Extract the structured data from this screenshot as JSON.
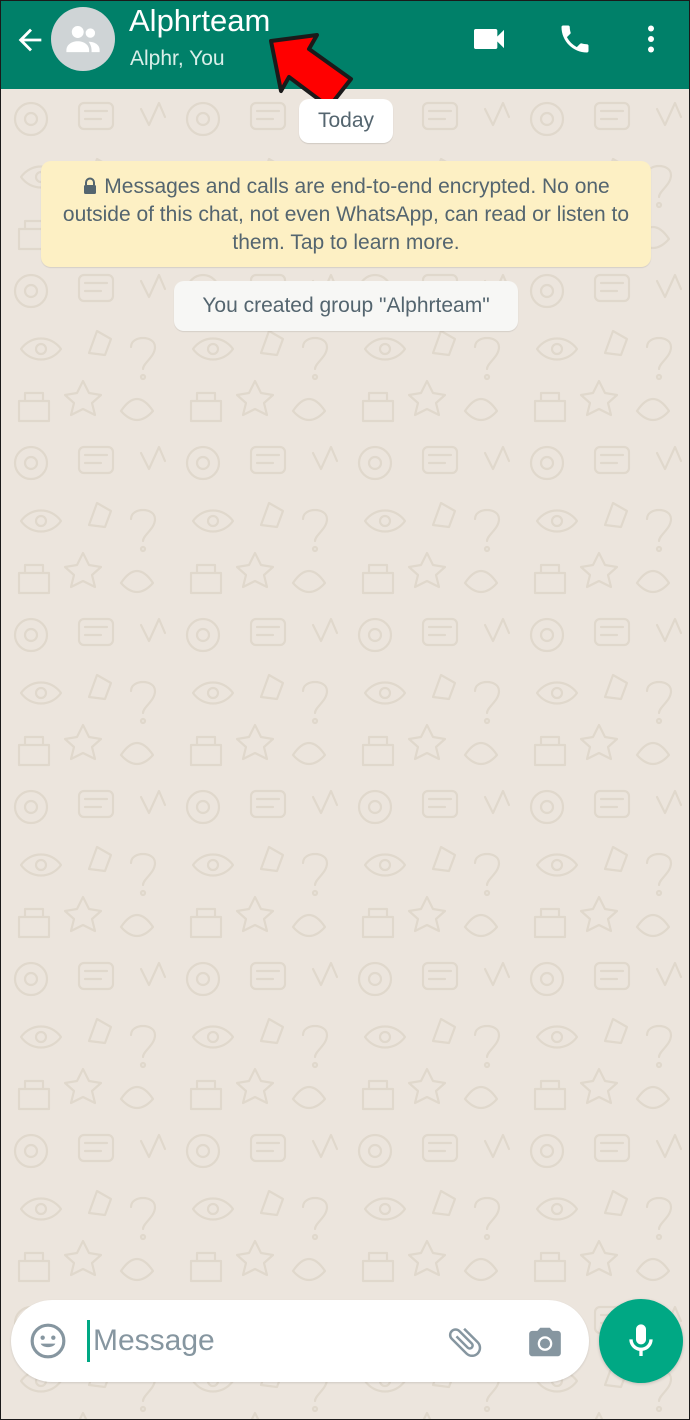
{
  "header": {
    "title": "Alphrteam",
    "subtitle": "Alphr, You",
    "icons": {
      "back": "arrow-back-icon",
      "avatar": "group-avatar-icon",
      "video_call": "videocam-icon",
      "voice_call": "phone-icon",
      "menu": "more-vert-icon"
    }
  },
  "chat": {
    "date_label": "Today",
    "encryption_notice": "Messages and calls are end-to-end encrypted. No one outside of this chat, not even WhatsApp, can read or listen to them. Tap to learn more.",
    "system_message": "You created group \"Alphrteam\""
  },
  "composer": {
    "placeholder": "Message",
    "value": "",
    "icons": {
      "emoji": "emoji-icon",
      "attach": "paperclip-icon",
      "camera": "camera-icon",
      "mic": "microphone-icon"
    }
  },
  "colors": {
    "header_bg": "#008069",
    "accent": "#00a884",
    "chat_bg": "#ece5dd",
    "notice_bg": "#fdf0c4",
    "annotation_arrow": "#ff0000"
  }
}
